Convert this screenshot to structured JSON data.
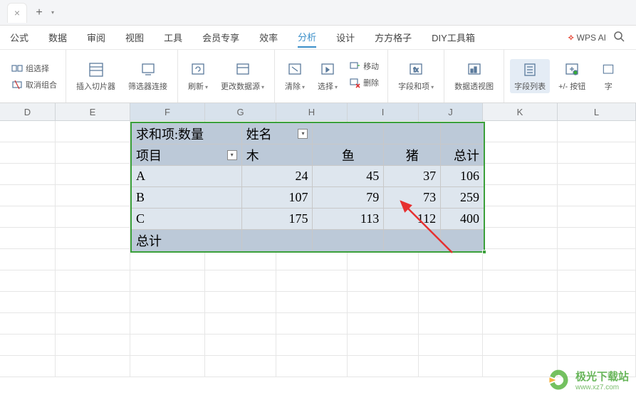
{
  "menu": {
    "items": [
      "公式",
      "数据",
      "审阅",
      "视图",
      "工具",
      "会员专享",
      "效率",
      "分析",
      "设计",
      "方方格子",
      "DIY工具箱"
    ],
    "active_index": 7,
    "wps_ai": "WPS AI"
  },
  "ribbon": {
    "group_select": "组选择",
    "cancel_group": "取消组合",
    "insert_slicer": "插入切片器",
    "filter_conn": "筛选器连接",
    "refresh": "刷新",
    "change_source": "更改数据源",
    "clear": "清除",
    "select": "选择",
    "move": "移动",
    "delete": "删除",
    "field_item": "字段和项",
    "pivot_chart": "数据透视图",
    "field_list": "字段列表",
    "plus_minus_btn": "+/- 按钮",
    "field": "字"
  },
  "columns": [
    "D",
    "E",
    "F",
    "G",
    "H",
    "I",
    "J",
    "K",
    "L"
  ],
  "pivot": {
    "sum_label": "求和项:数量",
    "name_label": "姓名",
    "project_label": "项目",
    "col_headers": [
      "木",
      "鱼",
      "猪",
      "总计"
    ],
    "row_labels": [
      "A",
      "B",
      "C"
    ],
    "grand_total_label": "总计"
  },
  "chart_data": {
    "type": "table",
    "title": "求和项:数量",
    "row_field": "项目",
    "col_field": "姓名",
    "columns": [
      "木",
      "鱼",
      "猪",
      "总计"
    ],
    "rows": [
      {
        "label": "A",
        "values": [
          24,
          45,
          37,
          106
        ]
      },
      {
        "label": "B",
        "values": [
          107,
          79,
          73,
          259
        ]
      },
      {
        "label": "C",
        "values": [
          175,
          113,
          112,
          400
        ]
      }
    ],
    "grand_total_row": "总计"
  },
  "watermark": {
    "name": "极光下载站",
    "url": "www.xz7.com"
  }
}
